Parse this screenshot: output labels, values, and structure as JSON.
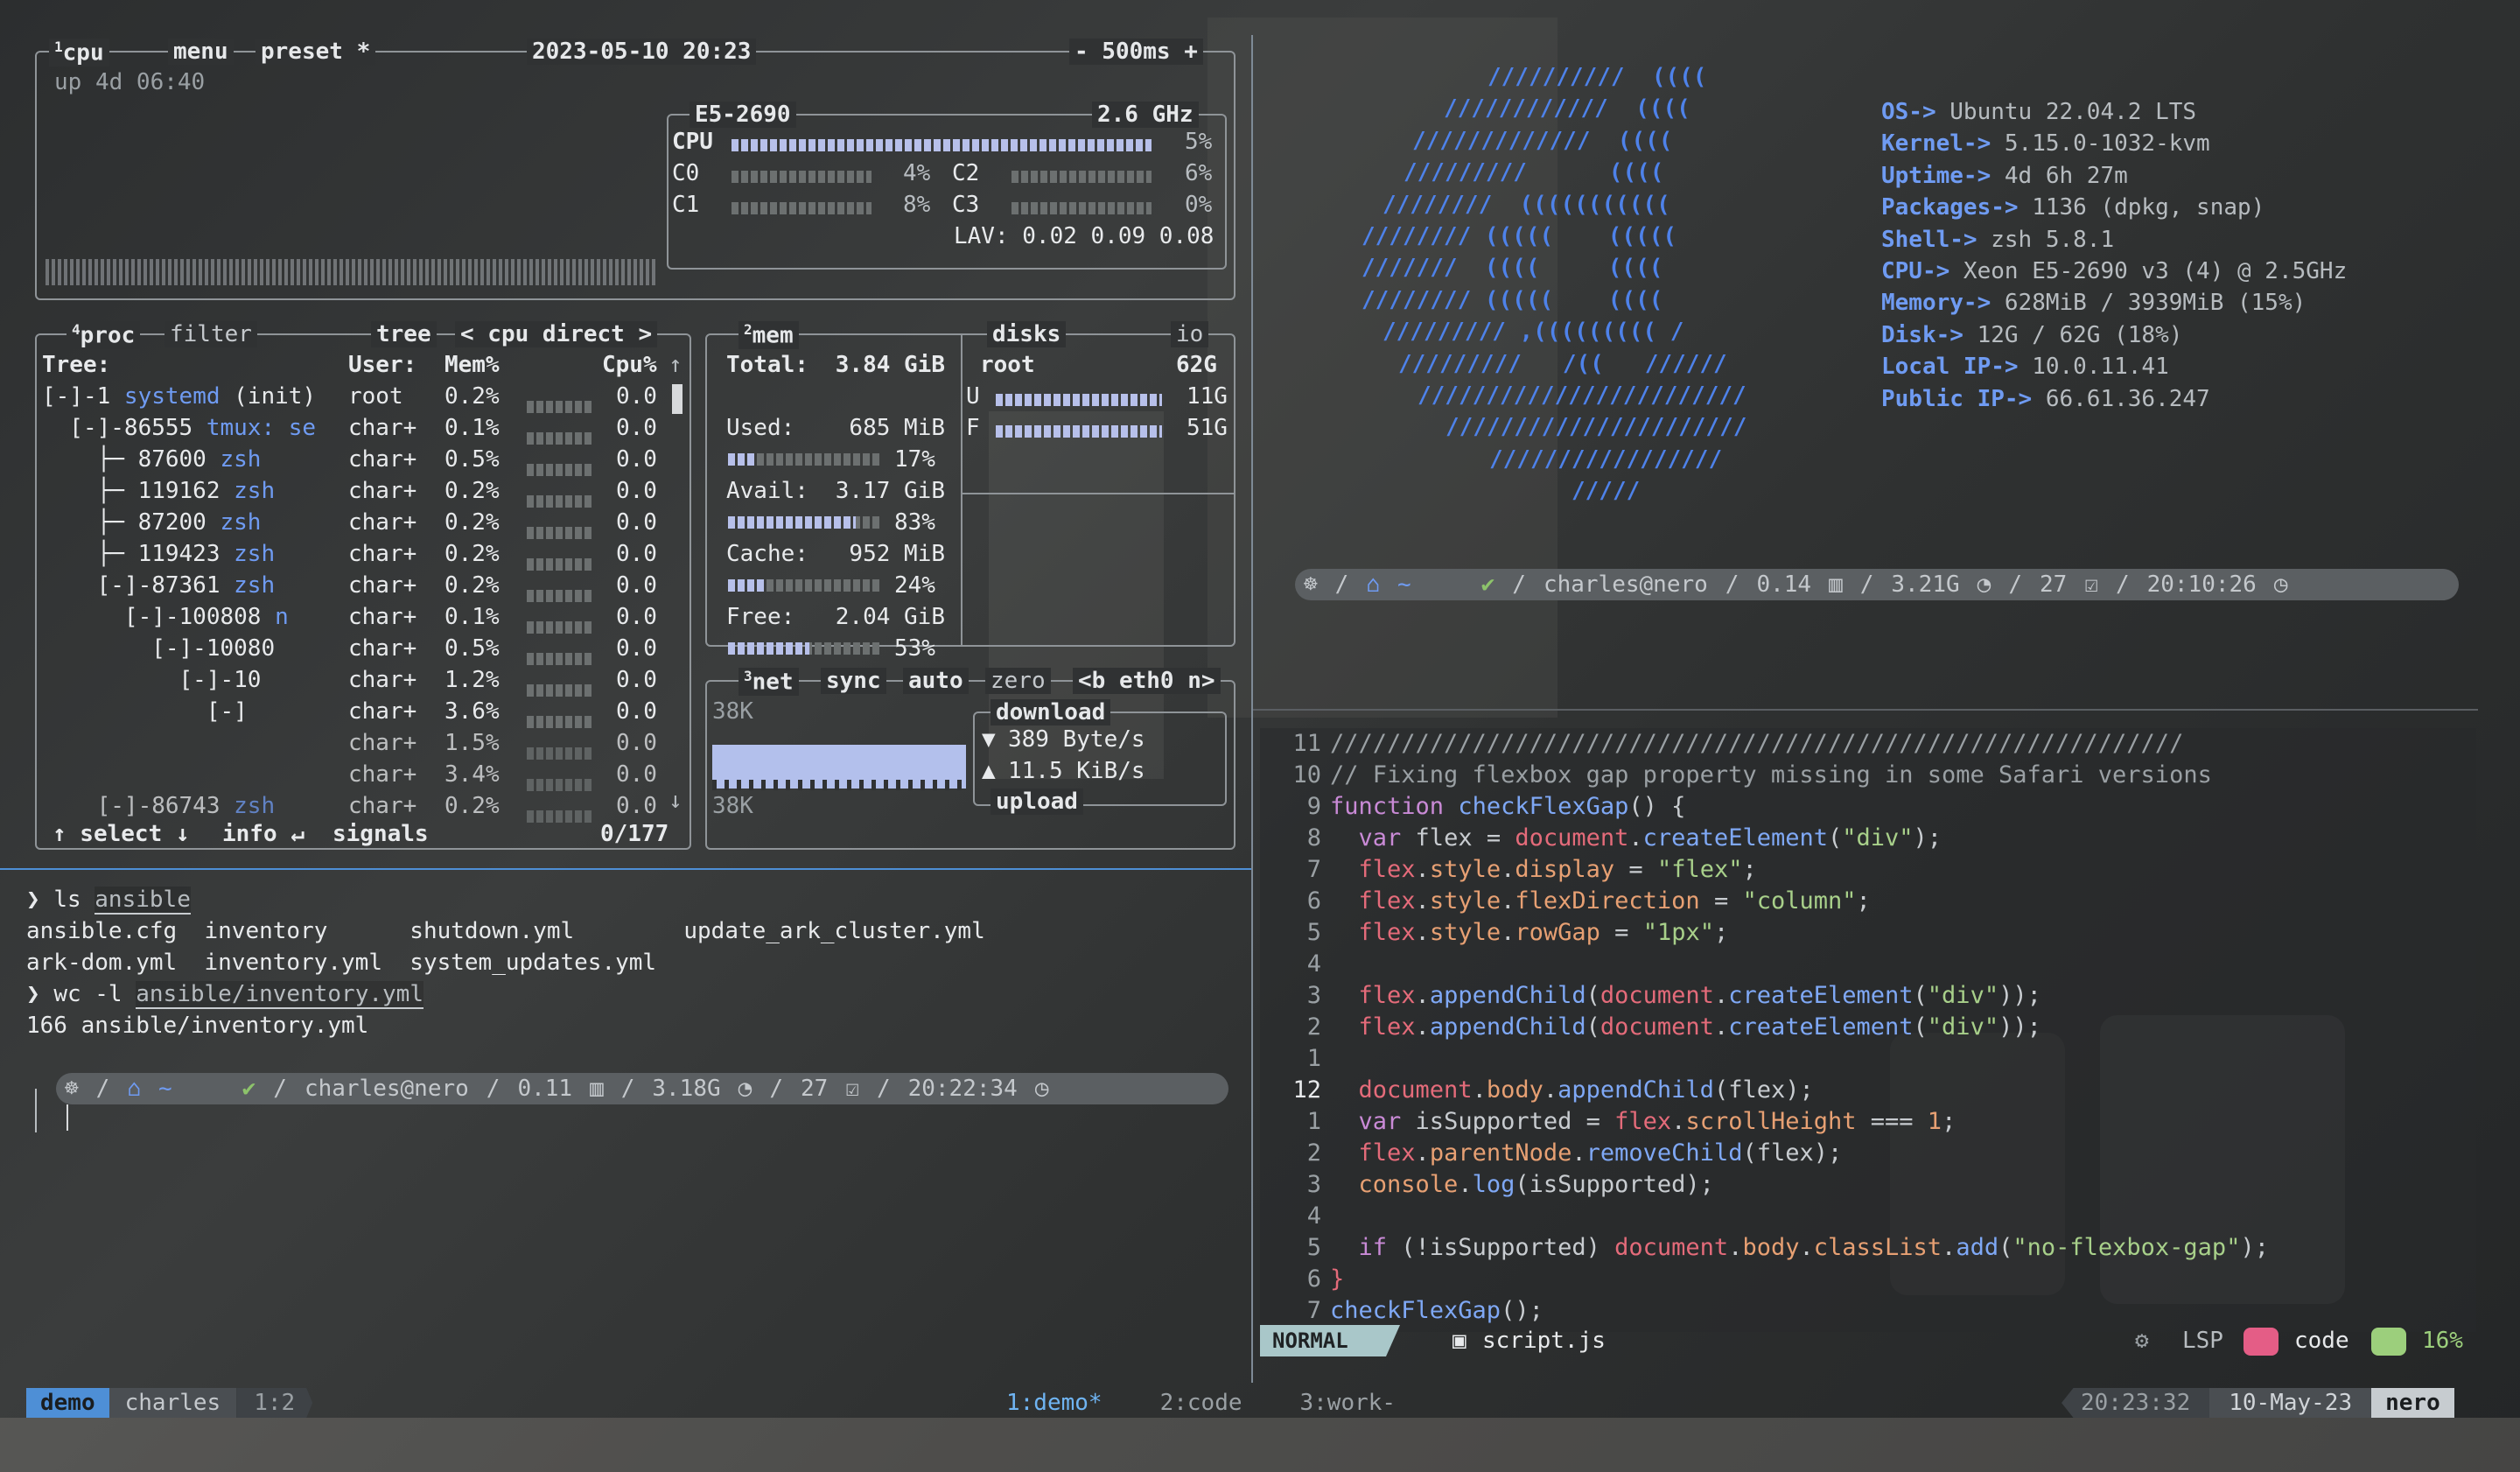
{
  "btop": {
    "cpu_tab": "cpu",
    "menu_tab": "menu",
    "preset_tab": "preset *",
    "datetime": "2023-05-10 20:23",
    "interval": "- 500ms +",
    "uptime": "up 4d 06:40",
    "cpu_model": "E5-2690",
    "cpu_freq": "2.6 GHz",
    "cpu_label": "CPU",
    "cpu_total": "5%",
    "cores": [
      {
        "name": "C0",
        "pct": "4%"
      },
      {
        "name": "C2",
        "pct": "6%"
      },
      {
        "name": "C1",
        "pct": "8%"
      },
      {
        "name": "C3",
        "pct": "0%"
      }
    ],
    "lav": "LAV: 0.02 0.09 0.08",
    "proc_tab": "proc",
    "filter_tab": "filter",
    "tree_tab": "tree",
    "sort_tab": "< cpu direct >",
    "proc_headers": {
      "tree": "Tree:",
      "user": "User:",
      "mem": "Mem%",
      "cpu": "Cpu%"
    },
    "procs": [
      {
        "tree": "[-]-1 ",
        "name": "systemd",
        "extra": " (init)",
        "user": "root",
        "mem": "0.2%",
        "cpu": "0.0"
      },
      {
        "tree": "  [-]-86555 ",
        "name": "tmux: se",
        "extra": "",
        "user": "char+",
        "mem": "0.1%",
        "cpu": "0.0"
      },
      {
        "tree": "    ├─ 87600 ",
        "name": "zsh",
        "extra": "",
        "user": "char+",
        "mem": "0.5%",
        "cpu": "0.0"
      },
      {
        "tree": "    ├─ 119162 ",
        "name": "zsh",
        "extra": "",
        "user": "char+",
        "mem": "0.2%",
        "cpu": "0.0"
      },
      {
        "tree": "    ├─ 87200 ",
        "name": "zsh",
        "extra": "",
        "user": "char+",
        "mem": "0.2%",
        "cpu": "0.0"
      },
      {
        "tree": "    ├─ 119423 ",
        "name": "zsh",
        "extra": "",
        "user": "char+",
        "mem": "0.2%",
        "cpu": "0.0"
      },
      {
        "tree": "    [-]-87361 ",
        "name": "zsh",
        "extra": "",
        "user": "char+",
        "mem": "0.2%",
        "cpu": "0.0"
      },
      {
        "tree": "      [-]-100808 ",
        "name": "n",
        "extra": "",
        "user": "char+",
        "mem": "0.1%",
        "cpu": "0.0"
      },
      {
        "tree": "        [-]-10080",
        "name": "",
        "extra": "",
        "user": "char+",
        "mem": "0.5%",
        "cpu": "0.0"
      },
      {
        "tree": "          [-]-10",
        "name": "",
        "extra": "",
        "user": "char+",
        "mem": "1.2%",
        "cpu": "0.0"
      },
      {
        "tree": "            [-]",
        "name": "",
        "extra": "",
        "user": "char+",
        "mem": "3.6%",
        "cpu": "0.0"
      },
      {
        "tree": "             ",
        "name": "",
        "extra": "",
        "user": "char+",
        "mem": "1.5%",
        "cpu": "0.0"
      },
      {
        "tree": "             ",
        "name": "",
        "extra": "",
        "user": "char+",
        "mem": "3.4%",
        "cpu": "0.0"
      },
      {
        "tree": "    [-]-86743 ",
        "name": "zsh",
        "extra": "",
        "user": "char+",
        "mem": "0.2%",
        "cpu": "0.0"
      }
    ],
    "proc_footer": {
      "select": "↑ select ↓",
      "info": "info ↵",
      "signals": "signals",
      "count": "0/177"
    },
    "mem_tab": "mem",
    "disks_tab": "disks",
    "io_tab": "io",
    "mem_rows": [
      {
        "label": "Total:",
        "value": "3.84 GiB",
        "pct": ""
      },
      {
        "label": "Used:",
        "value": "685 MiB",
        "pct": "17%",
        "fill": 0.17
      },
      {
        "label": "Avail:",
        "value": "3.17 GiB",
        "pct": "83%",
        "fill": 0.83
      },
      {
        "label": "Cache:",
        "value": "952 MiB",
        "pct": "24%",
        "fill": 0.24
      },
      {
        "label": "Free:",
        "value": "2.04 GiB",
        "pct": "53%",
        "fill": 0.53
      }
    ],
    "disk_name": "root",
    "disk_size": "62G",
    "disk_used": "11G",
    "disk_free": "51G",
    "disk_u": "U",
    "disk_f": "F",
    "net_tab": "net",
    "sync_tab": "sync",
    "auto_tab": "auto",
    "zero_tab": "zero",
    "iface": "<b eth0 n>",
    "net_top": "38K",
    "net_bottom": "38K",
    "download_label": "download",
    "download_val": "389 Byte/s",
    "upload_val": "11.5 KiB/s",
    "upload_label": "upload"
  },
  "term1": {
    "lines": [
      {
        "prompt": "❯",
        "cmd": "ls",
        "arg": "ansible"
      },
      {
        "out": "ansible.cfg  inventory      shutdown.yml        update_ark_cluster.yml"
      },
      {
        "out": "ark-dom.yml  inventory.yml  system_updates.yml"
      },
      {
        "prompt": "❯",
        "cmd": "wc -l",
        "arg": "ansible/inventory.yml"
      },
      {
        "out": "166 ansible/inventory.yml"
      }
    ]
  },
  "prompt_left": {
    "user": "charles@nero",
    "load": "0.11",
    "mem": "3.18G",
    "count": "27",
    "time": "20:22:34",
    "home": "~",
    "check": "✔"
  },
  "prompt_right": {
    "user": "charles@nero",
    "load": "0.14",
    "mem": "3.21G",
    "count": "27",
    "time": "20:10:26",
    "home": "~",
    "check": "✔"
  },
  "fetch": {
    "logo": [
      "//////////  ((((",
      "////////////  ((((",
      "/////////////  ((((",
      "/////////      ((((",
      "////////  (((((((((((",
      "//////// (((((    (((((",
      "///////  ((((     ((((",
      "//////// (((((    ((((",
      "///////// ,((((((((( /",
      "/////////   /((   //////",
      "////////////////////////",
      "//////////////////////",
      "/////////////////",
      "/////"
    ],
    "rows": [
      {
        "k": "OS->",
        "v": " Ubuntu 22.04.2 LTS"
      },
      {
        "k": "Kernel->",
        "v": " 5.15.0-1032-kvm"
      },
      {
        "k": "Uptime->",
        "v": " 4d 6h 27m"
      },
      {
        "k": "Packages->",
        "v": " 1136 (dpkg, snap)"
      },
      {
        "k": "Shell->",
        "v": " zsh 5.8.1"
      },
      {
        "k": "CPU->",
        "v": " Xeon E5-2690 v3 (4) @ 2.5GHz"
      },
      {
        "k": "Memory->",
        "v": " 628MiB / 3939MiB (15%)"
      },
      {
        "k": "Disk->",
        "v": " 12G / 62G (18%)"
      },
      {
        "k": "Local IP->",
        "v": " 10.0.11.41"
      },
      {
        "k": "Public IP->",
        "v": " 66.61.36.247"
      }
    ]
  },
  "editor": {
    "line_numbers": [
      "11",
      "10",
      "9",
      "8",
      "7",
      "6",
      "5",
      "4",
      "3",
      "2",
      "1",
      "12",
      "1",
      "2",
      "3",
      "4",
      "5",
      "6",
      "7"
    ],
    "code_lines": [
      "////////////////////////////////////////////////////////////",
      "// Fixing flexbox gap property missing in some Safari versions",
      "function checkFlexGap() {",
      "  var flex = document.createElement(\"div\");",
      "  flex.style.display = \"flex\";",
      "  flex.style.flexDirection = \"column\";",
      "  flex.style.rowGap = \"1px\";",
      "",
      "  flex.appendChild(document.createElement(\"div\"));",
      "  flex.appendChild(document.createElement(\"div\"));",
      "",
      "  document.body.appendChild(flex);",
      "  var isSupported = flex.scrollHeight === 1;",
      "  flex.parentNode.removeChild(flex);",
      "  console.log(isSupported);",
      "",
      "  if (!isSupported) document.body.classList.add(\"no-flexbox-gap\");",
      "}",
      "checkFlexGap();"
    ],
    "mode": "NORMAL",
    "file": "script.js",
    "lsp": "LSP",
    "workspace": "code",
    "percent": "16%"
  },
  "tmux": {
    "session": "demo",
    "user": "charles",
    "pane": "1:2",
    "windows": [
      "1:demo*",
      "2:code",
      "3:work-"
    ],
    "time": "20:23:32",
    "date": "10-May-23",
    "host": "nero"
  },
  "colors": {
    "accent": "#6f9bf2",
    "session_bg": "#4e8fd6",
    "mode_bg": "#a9c7c9"
  }
}
